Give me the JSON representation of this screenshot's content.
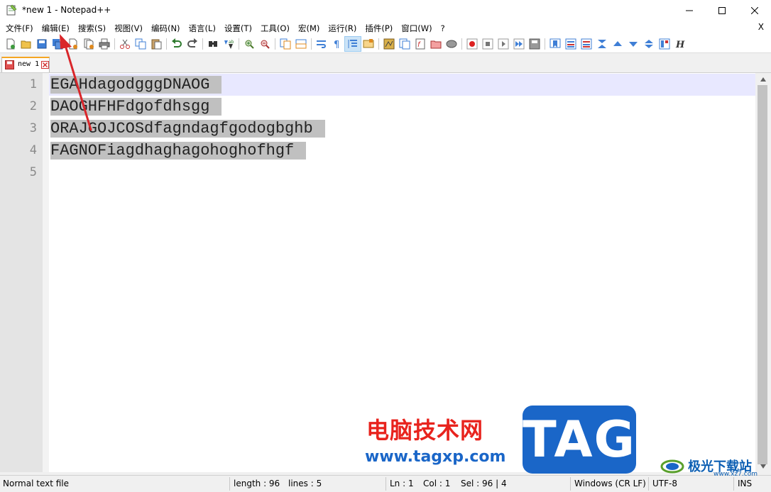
{
  "window": {
    "title": "*new 1 - Notepad++",
    "doc_close": "X"
  },
  "menu": {
    "items": [
      "文件(F)",
      "编辑(E)",
      "搜索(S)",
      "视图(V)",
      "编码(N)",
      "语言(L)",
      "设置(T)",
      "工具(O)",
      "宏(M)",
      "运行(R)",
      "插件(P)",
      "窗口(W)",
      "?"
    ]
  },
  "toolbar": {
    "icons": [
      "new-file-icon",
      "open-file-icon",
      "save-icon",
      "save-all-icon",
      "close-icon",
      "close-all-icon",
      "print-icon",
      "cut-icon",
      "copy-icon",
      "paste-icon",
      "undo-icon",
      "redo-icon",
      "find-icon",
      "replace-icon",
      "zoom-in-icon",
      "zoom-out-icon",
      "sync-vertical-icon",
      "sync-horizontal-icon",
      "word-wrap-icon",
      "show-all-chars-icon",
      "indent-guide-icon",
      "doc-map-icon",
      "function-list-icon",
      "folder-workspace-icon",
      "doc-list-icon",
      "monitoring-icon",
      "record-macro-icon",
      "stop-record-icon",
      "play-macro-icon",
      "run-macro-multiple-icon",
      "save-macro-icon"
    ]
  },
  "tabs": [
    {
      "label": "new 1"
    }
  ],
  "editor": {
    "line_numbers": [
      "1",
      "2",
      "3",
      "4",
      "5"
    ],
    "lines": [
      "EGAHdagodgggDNAOG",
      "DAOGHFHFdgofdhsgg",
      "ORAJGOJCOSdfagndagfgodogbghb",
      "FAGNOFiagdhaghagohoghofhgf",
      ""
    ]
  },
  "status": {
    "file_type": "Normal text file",
    "length": "length : 96",
    "lines": "lines : 5",
    "ln": "Ln : 1",
    "col": "Col : 1",
    "sel": "Sel : 96 | 4",
    "eol": "Windows (CR LF)",
    "encoding": "UTF-8",
    "mode": "INS"
  },
  "watermark": {
    "site_cn": "电脑技术网",
    "tag": "TAG",
    "url": "www.tagxp.com",
    "brand2": "极光下载站",
    "brand2_url": "www.xz7.com"
  },
  "colors": {
    "selection": "#c0c0c0",
    "caret_line": "#e8e8ff",
    "annotation_arrow": "#d9262a",
    "tab_accent": "#f5a623"
  }
}
